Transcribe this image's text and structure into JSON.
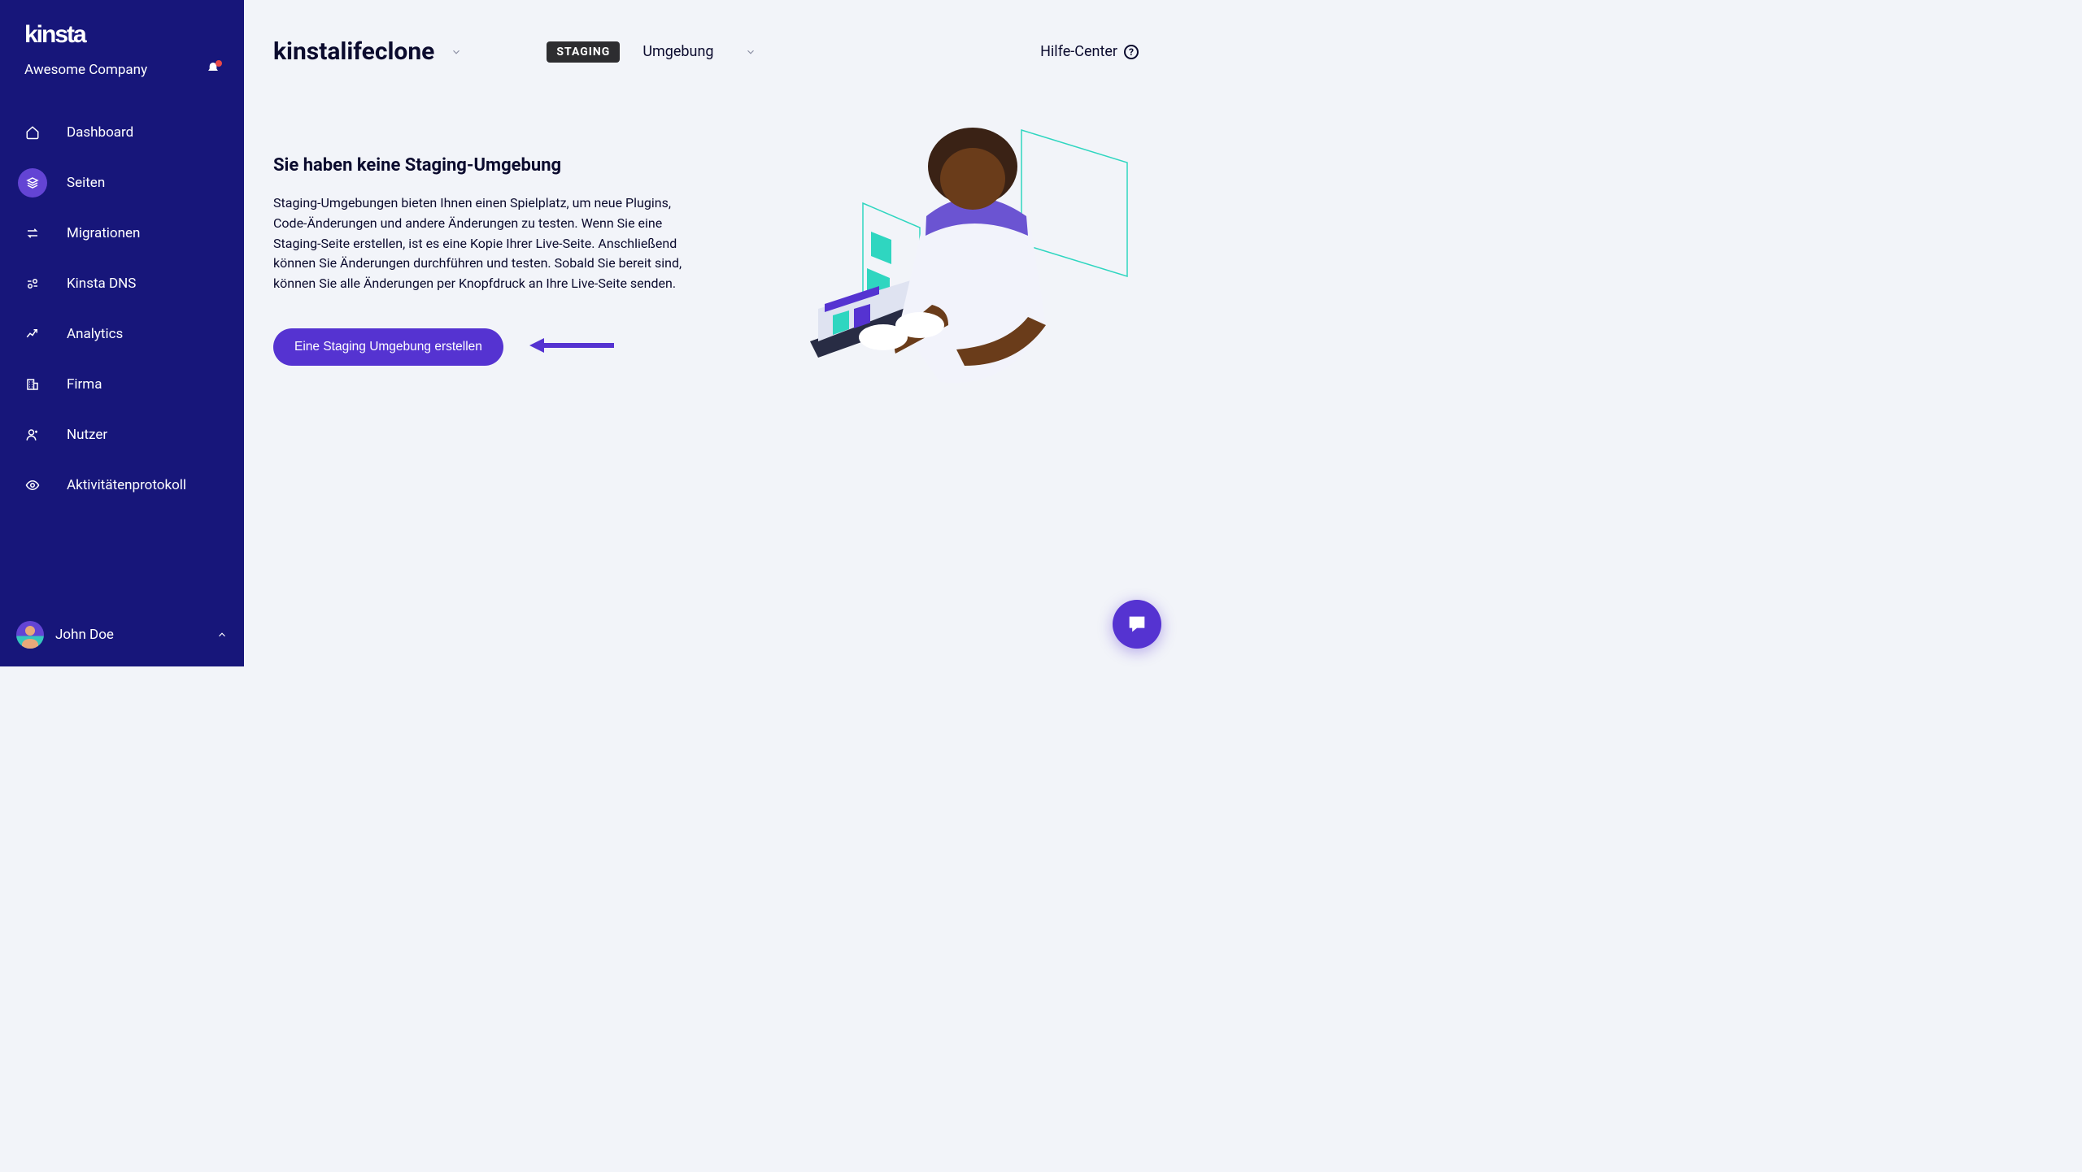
{
  "brand": "kinsta",
  "company_name": "Awesome Company",
  "sidebar": {
    "items": [
      {
        "label": "Dashboard",
        "icon": "home-icon"
      },
      {
        "label": "Seiten",
        "icon": "stack-icon",
        "active": true
      },
      {
        "label": "Migrationen",
        "icon": "swap-icon"
      },
      {
        "label": "Kinsta DNS",
        "icon": "dns-icon"
      },
      {
        "label": "Analytics",
        "icon": "analytics-icon"
      },
      {
        "label": "Firma",
        "icon": "building-icon"
      },
      {
        "label": "Nutzer",
        "icon": "user-add-icon"
      },
      {
        "label": "Aktivitätenprotokoll",
        "icon": "eye-icon"
      }
    ]
  },
  "user_name": "John Doe",
  "topbar": {
    "site_title": "kinstalifeclone",
    "badge": "STAGING",
    "env_label": "Umgebung",
    "help_center": "Hilfe-Center"
  },
  "content": {
    "heading": "Sie haben keine Staging-Umgebung",
    "description": "Staging-Umgebungen bieten Ihnen einen Spielplatz, um neue Plugins, Code-Änderungen und andere Änderungen zu testen. Wenn Sie eine Staging-Seite erstellen, ist es eine Kopie Ihrer Live-Seite. Anschließend können Sie Änderungen durchführen und testen. Sobald Sie bereit sind, können Sie alle Änderungen per Knopfdruck an Ihre Live-Seite senden.",
    "cta": "Eine Staging Umgebung erstellen"
  },
  "colors": {
    "sidebar_bg": "#17167a",
    "accent": "#5533d1",
    "active_nav": "#6344d4",
    "body_bg": "#f2f4f9",
    "text": "#0b0b2e"
  }
}
